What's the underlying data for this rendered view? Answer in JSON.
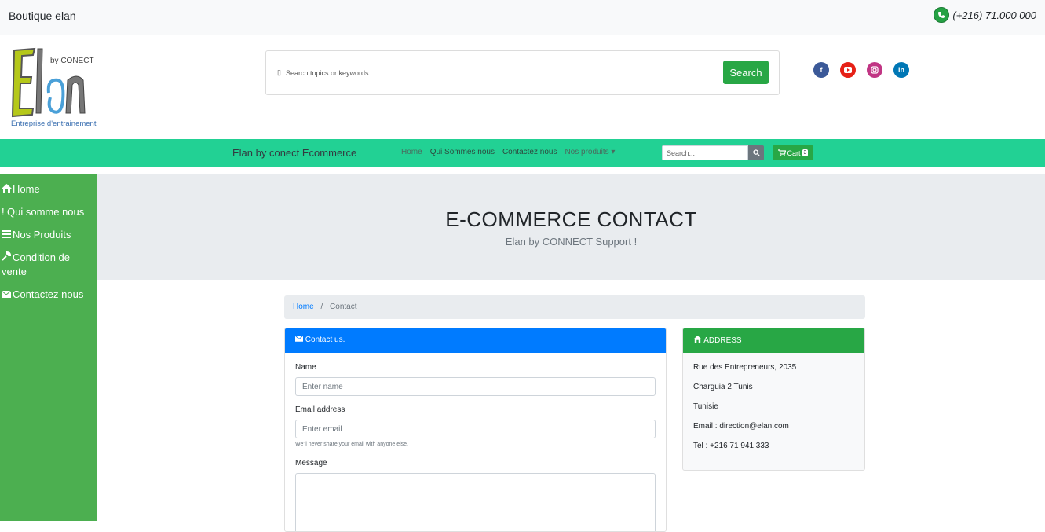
{
  "topbar": {
    "brand": "Boutique elan",
    "phone": "(+216) 71.000 000"
  },
  "logo": {
    "main": "Elan",
    "by": "by CONECT",
    "tagline": "Entreprise d'entrainement"
  },
  "search": {
    "placeholder": "Search topics or keywords",
    "button": "Search",
    "icon": "search-icon"
  },
  "socials": [
    {
      "name": "facebook-icon",
      "color": "#3b5998"
    },
    {
      "name": "youtube-icon",
      "color": "#e62117"
    },
    {
      "name": "instagram-icon",
      "color": "#c13584"
    },
    {
      "name": "linkedin-icon",
      "color": "#0077b5"
    }
  ],
  "navbar": {
    "brand": "Elan by conect Ecommerce",
    "links": [
      "Home",
      "Qui Sommes nous",
      "Contactez nous",
      "Nos produits"
    ],
    "search_placeholder": "Search...",
    "cart_label": "Cart",
    "cart_count": "3"
  },
  "sidebar": {
    "items": [
      {
        "label": "Home",
        "icon": "home-icon"
      },
      {
        "label": "Qui somme nous",
        "icon": "exclamation-icon"
      },
      {
        "label": "Nos Produits",
        "icon": "bars-icon"
      },
      {
        "label": "Condition de vente",
        "icon": "wrench-icon"
      },
      {
        "label": "Contactez nous",
        "icon": "envelope-icon"
      }
    ]
  },
  "jumbotron": {
    "title": "E-COMMERCE CONTACT",
    "subtitle": "Elan by CONNECT Support !"
  },
  "breadcrumb": {
    "home": "Home",
    "separator": "/",
    "current": "Contact"
  },
  "contact": {
    "header": "Contact us.",
    "name_label": "Name",
    "name_placeholder": "Enter name",
    "email_label": "Email address",
    "email_placeholder": "Enter email",
    "email_help": "We'll never share your email with anyone else.",
    "message_label": "Message"
  },
  "address": {
    "header": "ADDRESS",
    "lines": [
      "Rue des Entrepreneurs, 2035",
      "Charguia 2 Tunis",
      "Tunisie",
      "Email : direction@elan.com",
      "Tel : +216 71 941 333"
    ]
  },
  "colors": {
    "navbar": "#22d194",
    "sidebar": "#4caf50",
    "primary": "#007bff",
    "success": "#28a745"
  }
}
